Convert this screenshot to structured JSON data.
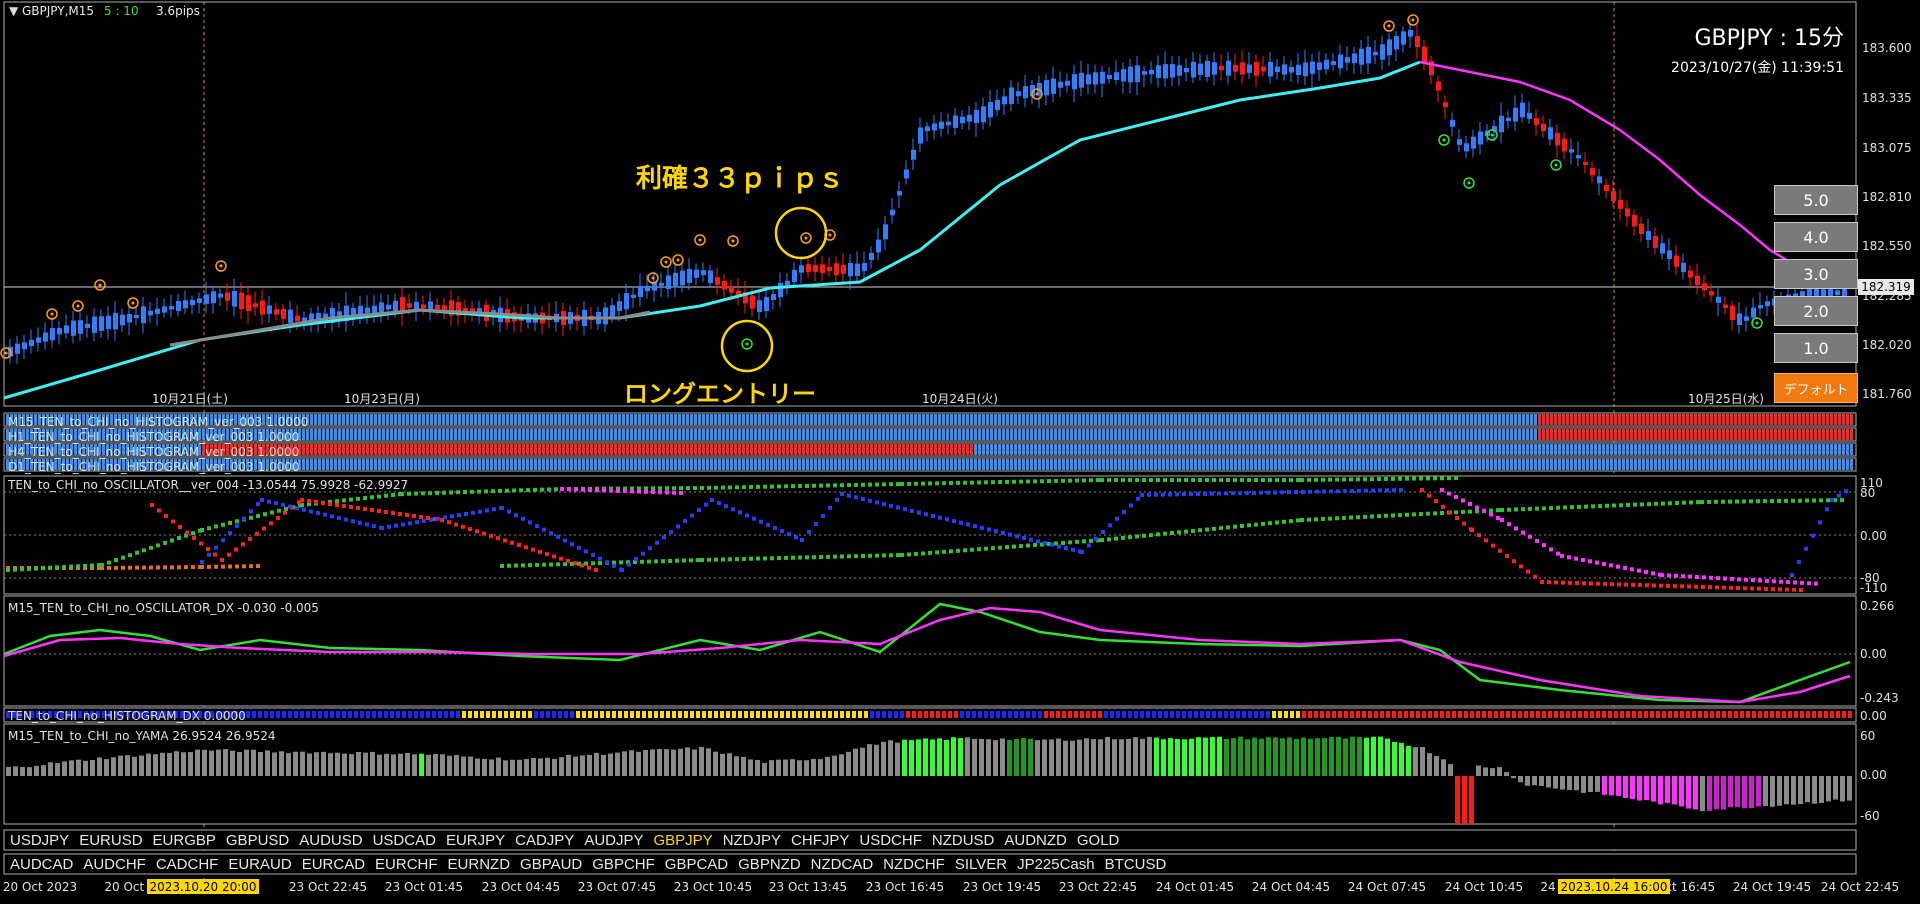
{
  "header": {
    "symbol_timeframe": "GBPJPY,M15",
    "countdown": "5 : 10",
    "spread": "3.6pips",
    "big_title": "GBPJPY : 15分",
    "datetime": "2023/10/27(金) 11:39:51"
  },
  "annotations": {
    "profit": "利確３３ｐｉｐｓ",
    "entry": "ロングエントリー"
  },
  "price_axis": {
    "ticks": [
      "183.600",
      "183.335",
      "183.075",
      "182.810",
      "182.550",
      "182.285",
      "182.020",
      "181.760"
    ],
    "current_price": "182.319"
  },
  "day_labels": [
    "10月21日(土)",
    "10月23日(月)",
    "10月24日(火)",
    "10月25日(水)"
  ],
  "histogram_panels": [
    "M15_TEN_to_CHI_no_HISTOGRAM_ver_003 1.0000",
    "H1_TEN_to_CHI_no_HISTOGRAM_ver_003 1.0000",
    "H4_TEN_to_CHI_no_HISTOGRAM_ver_003 1.0000",
    "D1_TEN_to_CHI_no_HISTOGRAM_ver_003 1.0000"
  ],
  "oscillator": {
    "label": "TEN_to_CHI_no_OSCILLATOR__ver_004 -13.0544 75.9928 -62.9927",
    "ticks": [
      "110",
      "80",
      "0.00",
      "-80",
      "-110"
    ]
  },
  "dx": {
    "label": "M15_TEN_to_CHI_no_OSCILLATOR_DX -0.030 -0.005",
    "ticks": [
      "0.266",
      "0.00",
      "-0.243"
    ]
  },
  "histogram_dx": {
    "label": "TEN_to_CHI_no_HISTOGRAM_DX 0.0000",
    "tick": "0.00"
  },
  "yama": {
    "label": "M15_TEN_to_CHI_no_YAMA 26.9524 26.9524",
    "ticks": [
      "60",
      "0.00",
      "-60"
    ]
  },
  "symbols_row1": [
    "USDJPY",
    "EURUSD",
    "EURGBP",
    "GBPUSD",
    "AUDUSD",
    "USDCAD",
    "EURJPY",
    "CADJPY",
    "AUDJPY",
    "GBPJPY",
    "NZDJPY",
    "CHFJPY",
    "USDCHF",
    "NZDUSD",
    "AUDNZD",
    "GOLD"
  ],
  "symbols_row2": [
    "AUDCAD",
    "AUDCHF",
    "CADCHF",
    "EURAUD",
    "EURCAD",
    "EURCHF",
    "EURNZD",
    "GBPAUD",
    "GBPCHF",
    "GBPCAD",
    "GBPNZD",
    "NZDCAD",
    "NZDCHF",
    "SILVER",
    "JP225Cash",
    "BTCUSD"
  ],
  "active_symbol": "GBPJPY",
  "time_axis": [
    "20 Oct 2023",
    "20 Oct 1",
    "23 Oct 22:45",
    "23 Oct 01:45",
    "23 Oct 04:45",
    "23 Oct 07:45",
    "23 Oct 10:45",
    "23 Oct 13:45",
    "23 Oct 16:45",
    "23 Oct 19:45",
    "23 Oct 22:45",
    "24 Oct 01:45",
    "24 Oct 04:45",
    "24 Oct 07:45",
    "24 Oct 10:45",
    "24",
    "24 Oct 16:45",
    "24 Oct 19:45",
    "24 Oct 22:45"
  ],
  "time_cursor_1": "2023.10.20 20:00",
  "time_cursor_2": "2023.10.24 16:00",
  "tf_buttons": [
    "5.0",
    "4.0",
    "3.0",
    "2.0",
    "1.0"
  ],
  "default_button": "デフォルト",
  "colors": {
    "bull": "#2f7fff",
    "bear": "#ff1a1a",
    "ma_fast": "#3ff0f0",
    "ma_slow": "#ff33ff",
    "signal_gold": "#ffd700",
    "histo_blue": "#3f8fe0",
    "histo_red": "#e03030",
    "green": "#33e033"
  }
}
